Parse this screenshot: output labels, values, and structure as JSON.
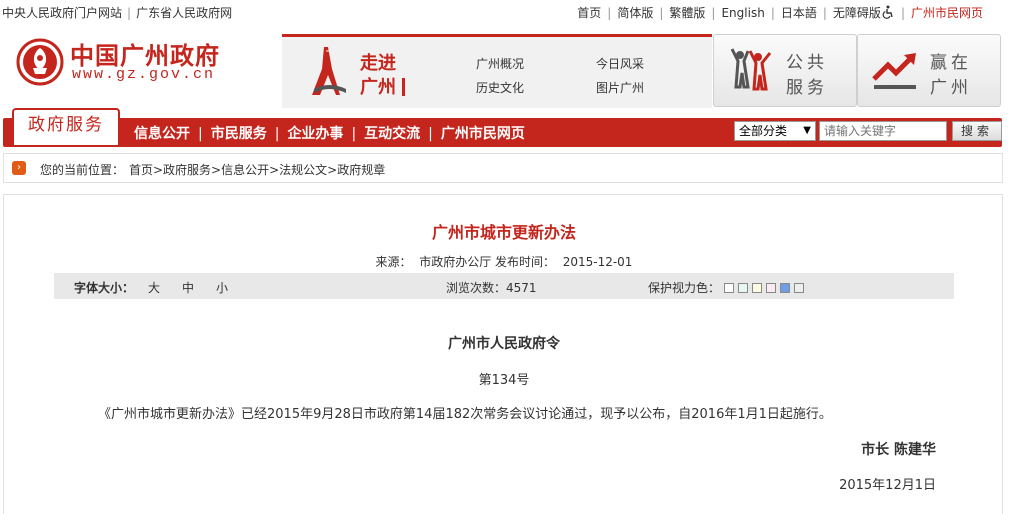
{
  "topbar": {
    "left_links": [
      "中央人民政府门户网站",
      "广东省人民政府网"
    ],
    "right_links": [
      "首页",
      "简体版",
      "繁體版",
      "English",
      "日本語",
      "无障碍版"
    ],
    "highlight_link": "广州市民网页"
  },
  "logo": {
    "name": "中国广州政府",
    "url": "www.gz.gov.cn"
  },
  "zoujin": {
    "title_line1": "走进",
    "title_line2": "广州",
    "links": [
      "广州概况",
      "今日风采",
      "历史文化",
      "图片广州"
    ]
  },
  "public_service": {
    "line1": "公共",
    "line2": "服务"
  },
  "win_guangzhou": {
    "line1": "赢在",
    "line2": "广州"
  },
  "nav": {
    "home_tab": "政府服务",
    "items": [
      "信息公开",
      "市民服务",
      "企业办事",
      "互动交流",
      "广州市民网页"
    ],
    "search_scope": "全部分类",
    "search_placeholder": "请输入关键字",
    "search_button": "搜索"
  },
  "breadcrumb": {
    "label": "您的当前位置：",
    "path": "首页>政府服务>信息公开>法规公文>政府规章"
  },
  "article": {
    "title": "广州市城市更新办法",
    "source_label": "来源：",
    "source": "市政府办公厅",
    "date_label": "发布时间：",
    "date": "2015-12-01",
    "font_size_label": "字体大小：",
    "font_sizes": [
      "大",
      "中",
      "小"
    ],
    "views_label": "浏览次数：",
    "views": "4571",
    "eye_color_label": "保护视力色：",
    "eye_colors": [
      "#ffffff",
      "#e9f7f3",
      "#fdfbe1",
      "#fbe9f0",
      "#6f9ee3",
      "#eeeeee"
    ],
    "decree_title": "广州市人民政府令",
    "decree_no": "第134号",
    "paragraph": "《广州市城市更新办法》已经2015年9月28日市政府第14届182次常务会议讨论通过，现予以公布，自2016年1月1日起施行。",
    "signature": "市长  陈建华",
    "sign_date": "2015年12月1日"
  },
  "colors": {
    "brand_red": "#c4251c",
    "crumb_icon": "#e25b16"
  }
}
